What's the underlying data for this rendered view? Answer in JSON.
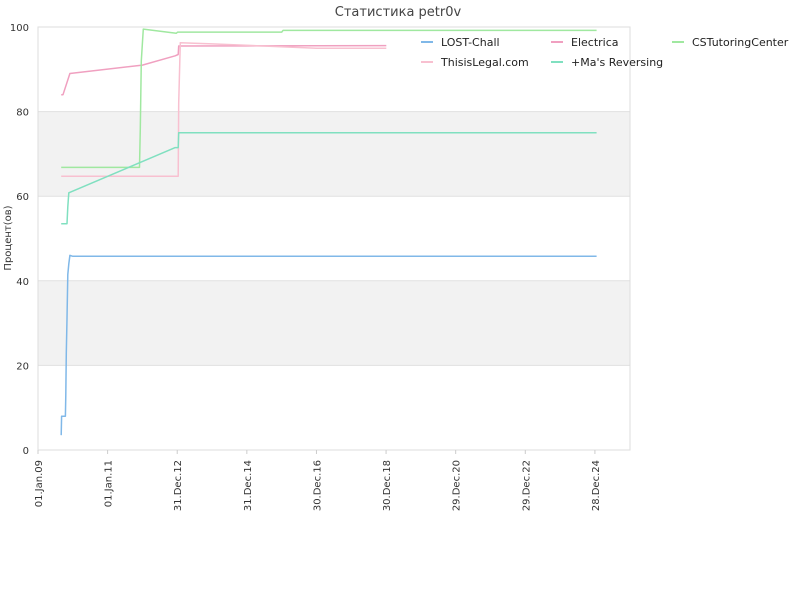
{
  "chart_data": {
    "type": "line",
    "title": "Статистика petr0v",
    "xlabel": "",
    "ylabel": "Процент(ов)",
    "ylim": [
      0,
      100
    ],
    "y_ticks": [
      0,
      20,
      40,
      60,
      80,
      100
    ],
    "x_range": [
      "2009-01-01",
      "2025-12-31"
    ],
    "x_ticks": [
      {
        "date": "2009-01-01",
        "label": "01.Jan.09"
      },
      {
        "date": "2011-01-01",
        "label": "01.Jan.11"
      },
      {
        "date": "2012-12-31",
        "label": "31.Dec.12"
      },
      {
        "date": "2014-12-31",
        "label": "31.Dec.14"
      },
      {
        "date": "2016-12-30",
        "label": "30.Dec.16"
      },
      {
        "date": "2018-12-30",
        "label": "30.Dec.18"
      },
      {
        "date": "2020-12-29",
        "label": "29.Dec.20"
      },
      {
        "date": "2022-12-29",
        "label": "29.Dec.22"
      },
      {
        "date": "2024-12-28",
        "label": "28.Dec.24"
      }
    ],
    "grid": "horizontal bands",
    "legend_position": "top-right",
    "series": [
      {
        "name": "LOST-Chall",
        "color": "#80b8e8",
        "points": [
          [
            "2009-09-01",
            3.5
          ],
          [
            "2009-09-05",
            8
          ],
          [
            "2009-10-15",
            8
          ],
          [
            "2009-10-20",
            13
          ],
          [
            "2009-10-25",
            23
          ],
          [
            "2009-11-01",
            31
          ],
          [
            "2009-11-10",
            41.5
          ],
          [
            "2009-11-20",
            44
          ],
          [
            "2009-12-01",
            46
          ],
          [
            "2010-01-01",
            45.8
          ],
          [
            "2025-01-15",
            45.8
          ]
        ]
      },
      {
        "name": "Electrica",
        "color": "#f0a0c0",
        "points": [
          [
            "2009-09-01",
            84
          ],
          [
            "2009-09-20",
            84
          ],
          [
            "2009-12-01",
            89
          ],
          [
            "2012-01-01",
            91
          ],
          [
            "2012-12-10",
            93.2
          ],
          [
            "2013-01-10",
            93.5
          ],
          [
            "2013-01-15",
            95.5
          ],
          [
            "2019-01-01",
            95.6
          ]
        ]
      },
      {
        "name": "CSTutoringCenter",
        "color": "#a0e8a0",
        "points": [
          [
            "2009-09-01",
            66.8
          ],
          [
            "2011-12-01",
            66.8
          ],
          [
            "2011-12-10",
            76
          ],
          [
            "2011-12-20",
            92
          ],
          [
            "2012-01-10",
            99.5
          ],
          [
            "2012-12-20",
            98.5
          ],
          [
            "2013-01-05",
            98.8
          ],
          [
            "2016-01-01",
            98.8
          ],
          [
            "2016-01-15",
            99.2
          ],
          [
            "2025-01-15",
            99.2
          ]
        ]
      },
      {
        "name": "ThisisLegal.com",
        "color": "#f8c0d0",
        "points": [
          [
            "2009-09-01",
            64.7
          ],
          [
            "2013-01-10",
            64.7
          ],
          [
            "2013-01-15",
            82
          ],
          [
            "2013-02-01",
            96.3
          ],
          [
            "2014-01-01",
            96
          ],
          [
            "2016-12-30",
            95
          ],
          [
            "2019-01-01",
            95
          ]
        ]
      },
      {
        "name": "+Ma's Reversing",
        "color": "#80e0c0",
        "points": [
          [
            "2009-09-01",
            53.5
          ],
          [
            "2009-11-01",
            53.5
          ],
          [
            "2009-11-10",
            57.5
          ],
          [
            "2009-11-20",
            60.8
          ],
          [
            "2012-12-10",
            71.5
          ],
          [
            "2013-01-10",
            71.5
          ],
          [
            "2013-01-15",
            75
          ],
          [
            "2025-01-15",
            75
          ]
        ]
      }
    ]
  }
}
